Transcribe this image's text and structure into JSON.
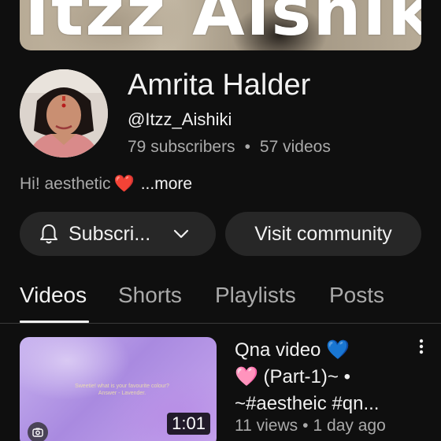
{
  "banner": {
    "text": "Itzz Aishiki"
  },
  "channel": {
    "name": "Amrita Halder",
    "handle": "@Itzz_Aishiki",
    "subscribers": "79 subscribers",
    "videos": "57 videos",
    "stats_separator": "•",
    "description": "Hi! aesthetic",
    "description_emoji": "❤️",
    "more_label": "...more"
  },
  "buttons": {
    "subscribe_label": "Subscri...",
    "community_label": "Visit community"
  },
  "tabs": [
    {
      "label": "Videos",
      "active": true
    },
    {
      "label": "Shorts",
      "active": false
    },
    {
      "label": "Playlists",
      "active": false
    },
    {
      "label": "Posts",
      "active": false
    }
  ],
  "video": {
    "title_lines": [
      "Qna video 💙",
      "🩷 (Part-1)~ •",
      "~#aestheic #qn..."
    ],
    "views": "11 views",
    "meta_separator": "•",
    "age": "1 day ago",
    "duration": "1:01",
    "thumbnail_caption": "Sweetie! what is your favourite colour? Answer - Lavender."
  },
  "colors": {
    "background": "#0f0f0f",
    "button_bg": "#272727",
    "text_primary": "#f1f1f1",
    "text_secondary": "#aaaaaa"
  },
  "icons": [
    "bell-icon",
    "chevron-down-icon",
    "kebab-menu-icon",
    "video-type-icon"
  ]
}
